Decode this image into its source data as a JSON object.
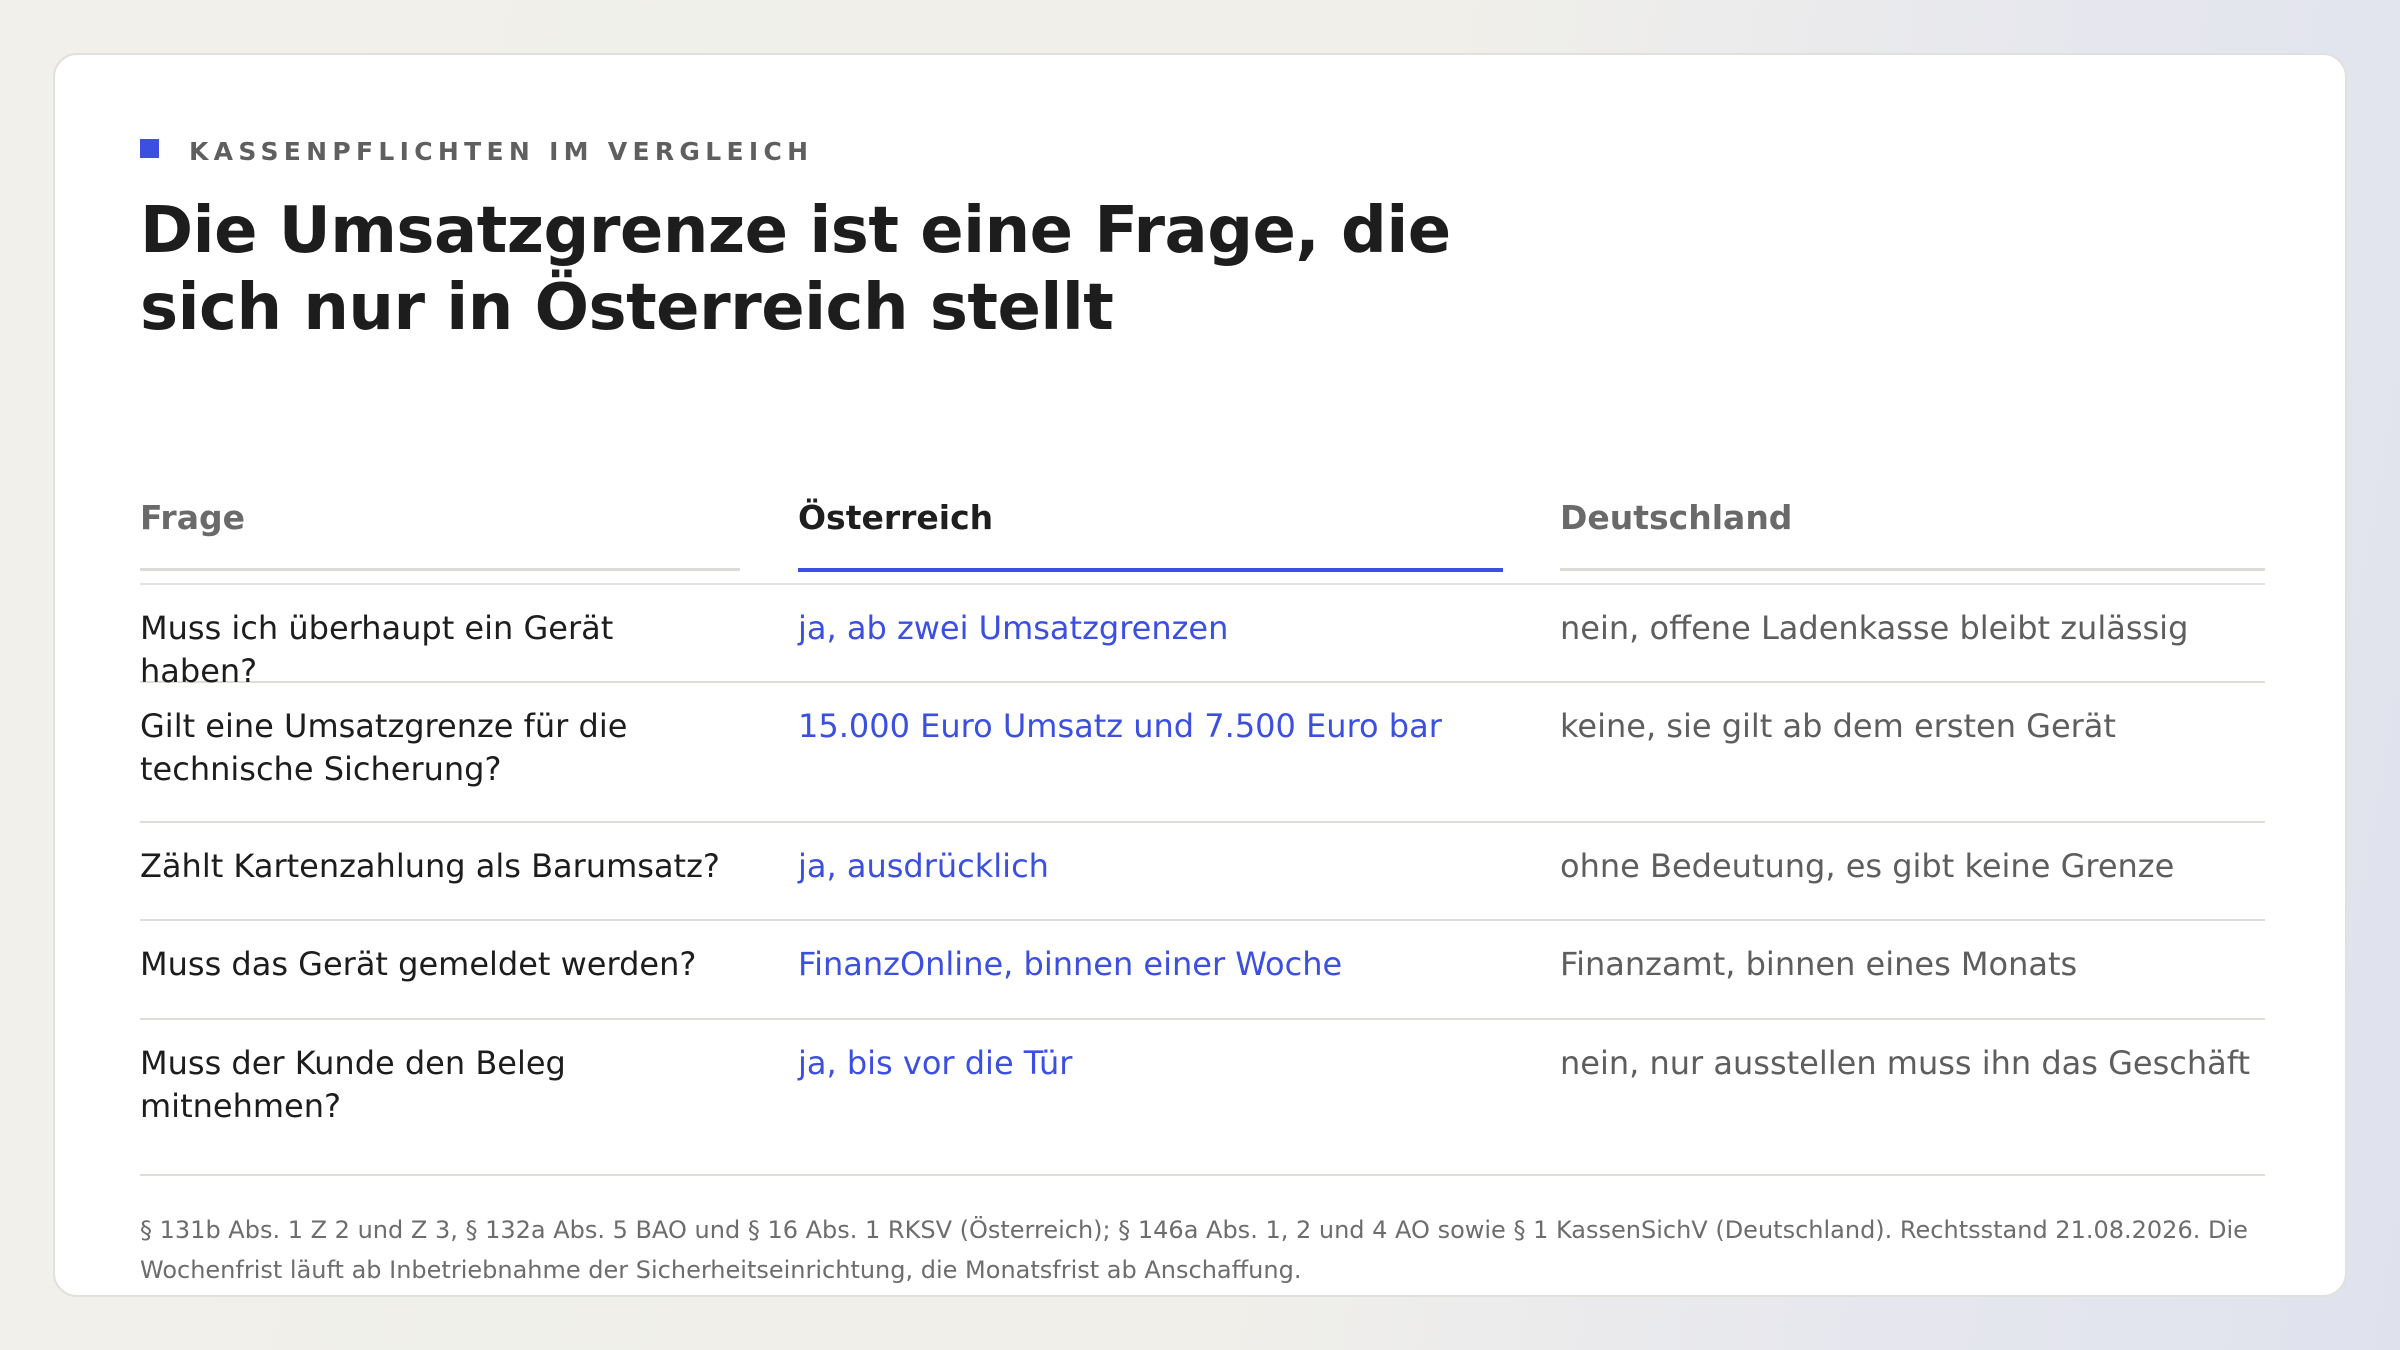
{
  "header": {
    "eyebrow": "KASSENPFLICHTEN IM VERGLEICH",
    "title_line1": "Die Umsatzgrenze ist eine Frage, die",
    "title_line2": "sich nur in Österreich stellt"
  },
  "table": {
    "columns": [
      "Frage",
      "Österreich",
      "Deutschland"
    ],
    "rows": [
      {
        "frage": "Muss ich überhaupt ein Gerät haben?",
        "oesterreich": "ja, ab zwei Umsatzgrenzen",
        "deutschland": "nein, offene Ladenkasse bleibt zulässig"
      },
      {
        "frage": "Gilt eine Umsatzgrenze für die technische Sicherung?",
        "oesterreich": "15.000 Euro Umsatz und 7.500 Euro bar",
        "deutschland": "keine, sie gilt ab dem ersten Gerät"
      },
      {
        "frage": "Zählt Kartenzahlung als Barumsatz?",
        "oesterreich": "ja, ausdrücklich",
        "deutschland": "ohne Bedeutung, es gibt keine Grenze"
      },
      {
        "frage": "Muss das Gerät gemeldet werden?",
        "oesterreich": "FinanzOnline, binnen einer Woche",
        "deutschland": "Finanzamt, binnen eines Monats"
      },
      {
        "frage": "Muss der Kunde den Beleg mitnehmen?",
        "oesterreich": "ja, bis vor die Tür",
        "deutschland": "nein, nur ausstellen muss ihn das Geschäft"
      }
    ]
  },
  "footnote": "§ 131b Abs. 1 Z 2 und Z 3, § 132a Abs. 5 BAO und § 16 Abs. 1 RKSV (Österreich); § 146a Abs. 1, 2 und 4 AO sowie § 1 KassenSichV (Deutschland). Rechtsstand 21.08.2026. Die Wochenfrist läuft ab Inbetriebnahme der Sicherheitseinrichtung, die Monatsfrist ab Anschaffung.",
  "colors": {
    "accent": "#3b4fe0",
    "text": "#1d1d1d",
    "muted": "#5e5e5e"
  }
}
